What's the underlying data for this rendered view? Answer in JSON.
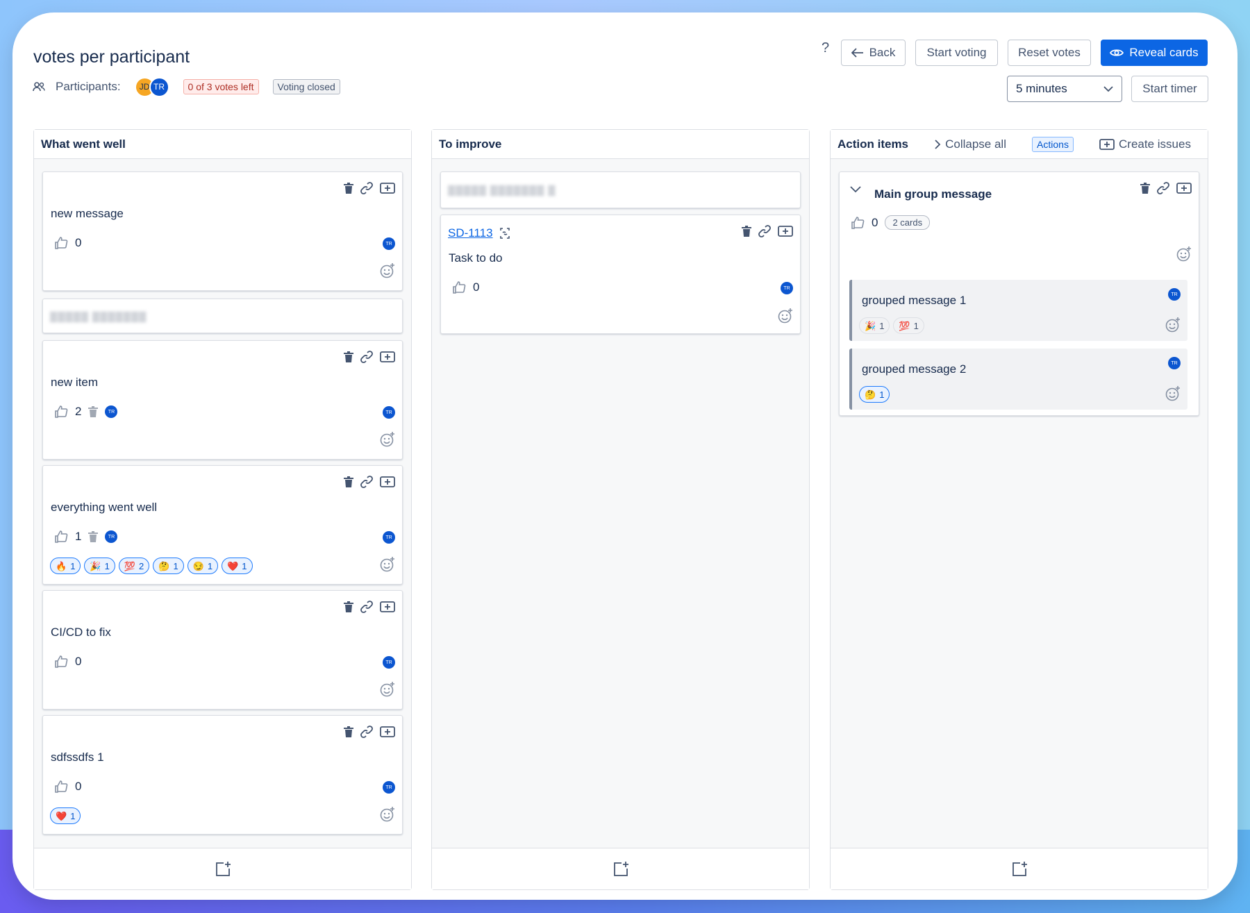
{
  "header": {
    "title": "votes per participant",
    "participants_label": "Participants:",
    "avatars": [
      "JD",
      "TR"
    ],
    "votes_left": "0 of 3 votes left",
    "voting_status": "Voting closed",
    "help": "?",
    "back": "Back",
    "start_voting": "Start voting",
    "reset_votes": "Reset votes",
    "reveal_cards": "Reveal cards",
    "timer_value": "5 minutes",
    "start_timer": "Start timer"
  },
  "columns": [
    {
      "title": "What went well",
      "cards": [
        {
          "text": "new message",
          "votes": "0",
          "author": "TR"
        },
        {
          "blurred": "▓▓▓▓▓ ▓▓▓▓▓▓▓"
        },
        {
          "text": "new item",
          "votes": "2",
          "voter": "TR",
          "author": "TR"
        },
        {
          "text": "everything went well",
          "votes": "1",
          "voter": "TR",
          "author": "TR",
          "reactions": [
            {
              "emoji": "🔥",
              "count": "1"
            },
            {
              "emoji": "🎉",
              "count": "1"
            },
            {
              "emoji": "💯",
              "count": "2"
            },
            {
              "emoji": "🤔",
              "count": "1"
            },
            {
              "emoji": "😏",
              "count": "1"
            },
            {
              "emoji": "❤️",
              "count": "1"
            }
          ]
        },
        {
          "text": "CI/CD to fix",
          "votes": "0",
          "author": "TR"
        },
        {
          "text": "sdfssdfs 1",
          "votes": "0",
          "author": "TR",
          "reactions": [
            {
              "emoji": "❤️",
              "count": "1"
            }
          ]
        }
      ]
    },
    {
      "title": "To improve",
      "cards": [
        {
          "blurred": "▓▓▓▓▓ ▓▓▓▓▓▓▓ ▓"
        },
        {
          "issue": "SD-1113",
          "text": "Task to do",
          "votes": "0",
          "author": "TR"
        }
      ]
    },
    {
      "title": "Action items",
      "collapse_all": "Collapse all",
      "actions_chip": "Actions",
      "create_issues": "Create issues",
      "group": {
        "title": "Main group message",
        "votes": "0",
        "count": "2 cards",
        "items": [
          {
            "text": "grouped message 1",
            "author": "TR",
            "reactions": [
              {
                "emoji": "🎉",
                "count": "1"
              },
              {
                "emoji": "💯",
                "count": "1"
              }
            ]
          },
          {
            "text": "grouped message 2",
            "author": "TR",
            "reactions": [
              {
                "emoji": "🤔",
                "count": "1"
              }
            ]
          }
        ]
      }
    }
  ],
  "colors": {
    "primary": "#0c66e4",
    "avatar_tr": "#0c56d0",
    "avatar_jd": "#f6a623",
    "badge_red": "#ffeceb"
  }
}
